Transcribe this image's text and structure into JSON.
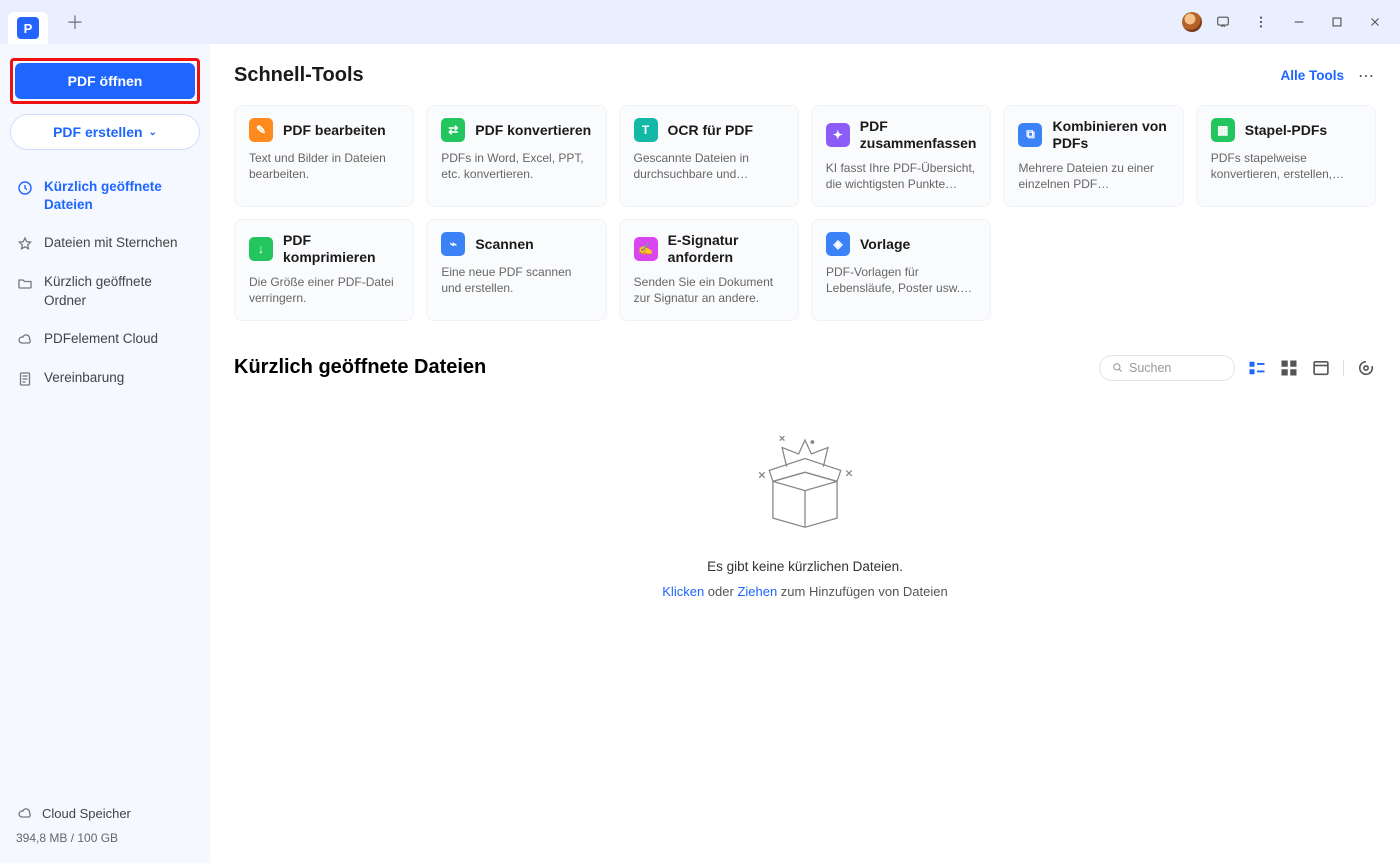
{
  "titlebar": {
    "plus_tooltip": "＋"
  },
  "sidebar": {
    "open_pdf": "PDF öffnen",
    "create_pdf": "PDF erstellen",
    "nav": {
      "recent_files": "Kürzlich geöffnete Dateien",
      "starred": "Dateien mit Sternchen",
      "recent_folders": "Kürzlich geöffnete Ordner",
      "cloud": "PDFelement Cloud",
      "agreement": "Vereinbarung"
    },
    "storage_label": "Cloud Speicher",
    "quota": "394,8 MB / 100 GB"
  },
  "tools": {
    "heading": "Schnell-Tools",
    "all_tools": "Alle Tools",
    "cards": [
      {
        "t": "PDF bearbeiten",
        "d": "Text und Bilder in Dateien bearbeiten.",
        "c": "#ff8a1e",
        "g": "✎"
      },
      {
        "t": "PDF konvertieren",
        "d": "PDFs in Word, Excel, PPT, etc. konvertieren.",
        "c": "#22c55e",
        "g": "⇄"
      },
      {
        "t": "OCR für PDF",
        "d": "Gescannte Dateien in durchsuchbare und bearbeit...",
        "c": "#14b8a6",
        "g": "T"
      },
      {
        "t": "PDF zusammenfassen",
        "d": "KI fasst Ihre PDF-Übersicht, die wichtigsten Punkte usw...",
        "c": "#8b5cf6",
        "g": "✦"
      },
      {
        "t": "Kombinieren von PDFs",
        "d": "Mehrere Dateien zu einer einzelnen PDF zusammenfü...",
        "c": "#3b82f6",
        "g": "⧉"
      },
      {
        "t": "Stapel-PDFs",
        "d": "PDFs stapelweise konvertieren, erstellen, druc...",
        "c": "#22c55e",
        "g": "▦"
      }
    ],
    "cards2": [
      {
        "t": "PDF komprimieren",
        "d": "Die Größe einer PDF-Datei verringern.",
        "c": "#22c55e",
        "g": "↓"
      },
      {
        "t": "Scannen",
        "d": "Eine neue PDF scannen und erstellen.",
        "c": "#3b82f6",
        "g": "⌁"
      },
      {
        "t": "E-Signatur anfordern",
        "d": "Senden Sie ein Dokument zur Signatur an andere.",
        "c": "#d946ef",
        "g": "✍"
      },
      {
        "t": "Vorlage",
        "d": "PDF-Vorlagen für Lebensläufe, Poster usw. erh...",
        "c": "#3b82f6",
        "g": "◈"
      }
    ]
  },
  "recent": {
    "heading": "Kürzlich geöffnete Dateien",
    "search_placeholder": "Suchen",
    "empty_title": "Es gibt keine kürzlichen Dateien.",
    "empty_click": "Klicken",
    "empty_or": " oder ",
    "empty_drag": "Ziehen",
    "empty_rest": " zum Hinzufügen von Dateien"
  }
}
